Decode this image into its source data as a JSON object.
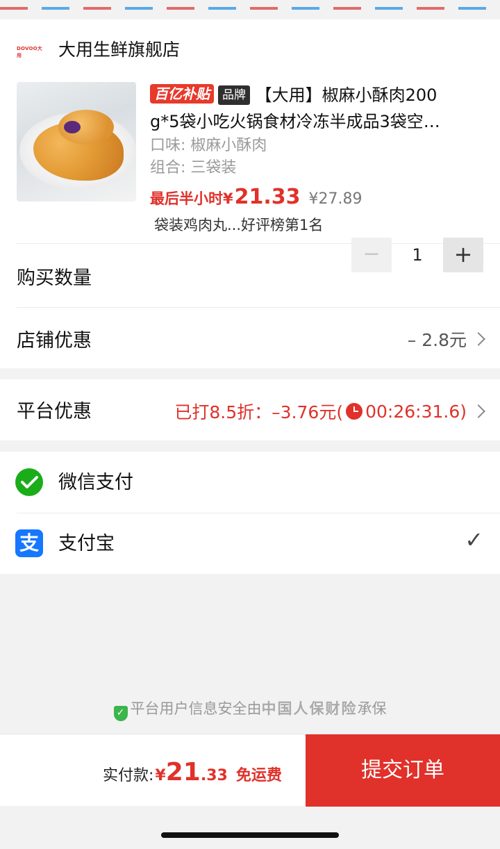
{
  "store": {
    "logo_text": "DOVOO大用",
    "name": "大用生鲜旗舰店"
  },
  "product": {
    "badge_subsidy": "百亿补贴",
    "badge_brand": "品牌",
    "title_line1": "【大用】椒麻小酥肉200",
    "title_line2": "g*5袋小吃火锅食材冷冻半成品3袋空…",
    "flavor": "口味: 椒麻小酥肉",
    "combo": "组合: 三袋装",
    "price_label": "最后半小时",
    "price_yen": "¥",
    "price": "21.33",
    "price_original": "¥27.89",
    "rank": "袋装鸡肉丸...好评榜第1名"
  },
  "quantity": {
    "label": "购买数量",
    "minus": "−",
    "value": "1",
    "plus": "+"
  },
  "store_discount": {
    "label": "店铺优惠",
    "value": "– 2.8元"
  },
  "platform_discount": {
    "label": "平台优惠",
    "value_prefix": "已打8.5折：–3.76元(",
    "countdown": "00:26:31.6",
    "value_suffix": ")"
  },
  "payment": {
    "wechat": {
      "label": "微信支付"
    },
    "alipay": {
      "label": "支付宝",
      "checkmark": "✓"
    }
  },
  "security_note": {
    "prefix": "平台用户信息安全由",
    "insurer": "中国人保财险",
    "suffix": "承保"
  },
  "footer": {
    "pay_label": "实付款:",
    "yen": "¥",
    "amount_int": "21",
    "amount_dec": ".33",
    "shipping": "免运费",
    "submit": "提交订单"
  },
  "colors": {
    "accent": "#e0312a",
    "wechat": "#1aad19",
    "alipay": "#1677ff"
  }
}
